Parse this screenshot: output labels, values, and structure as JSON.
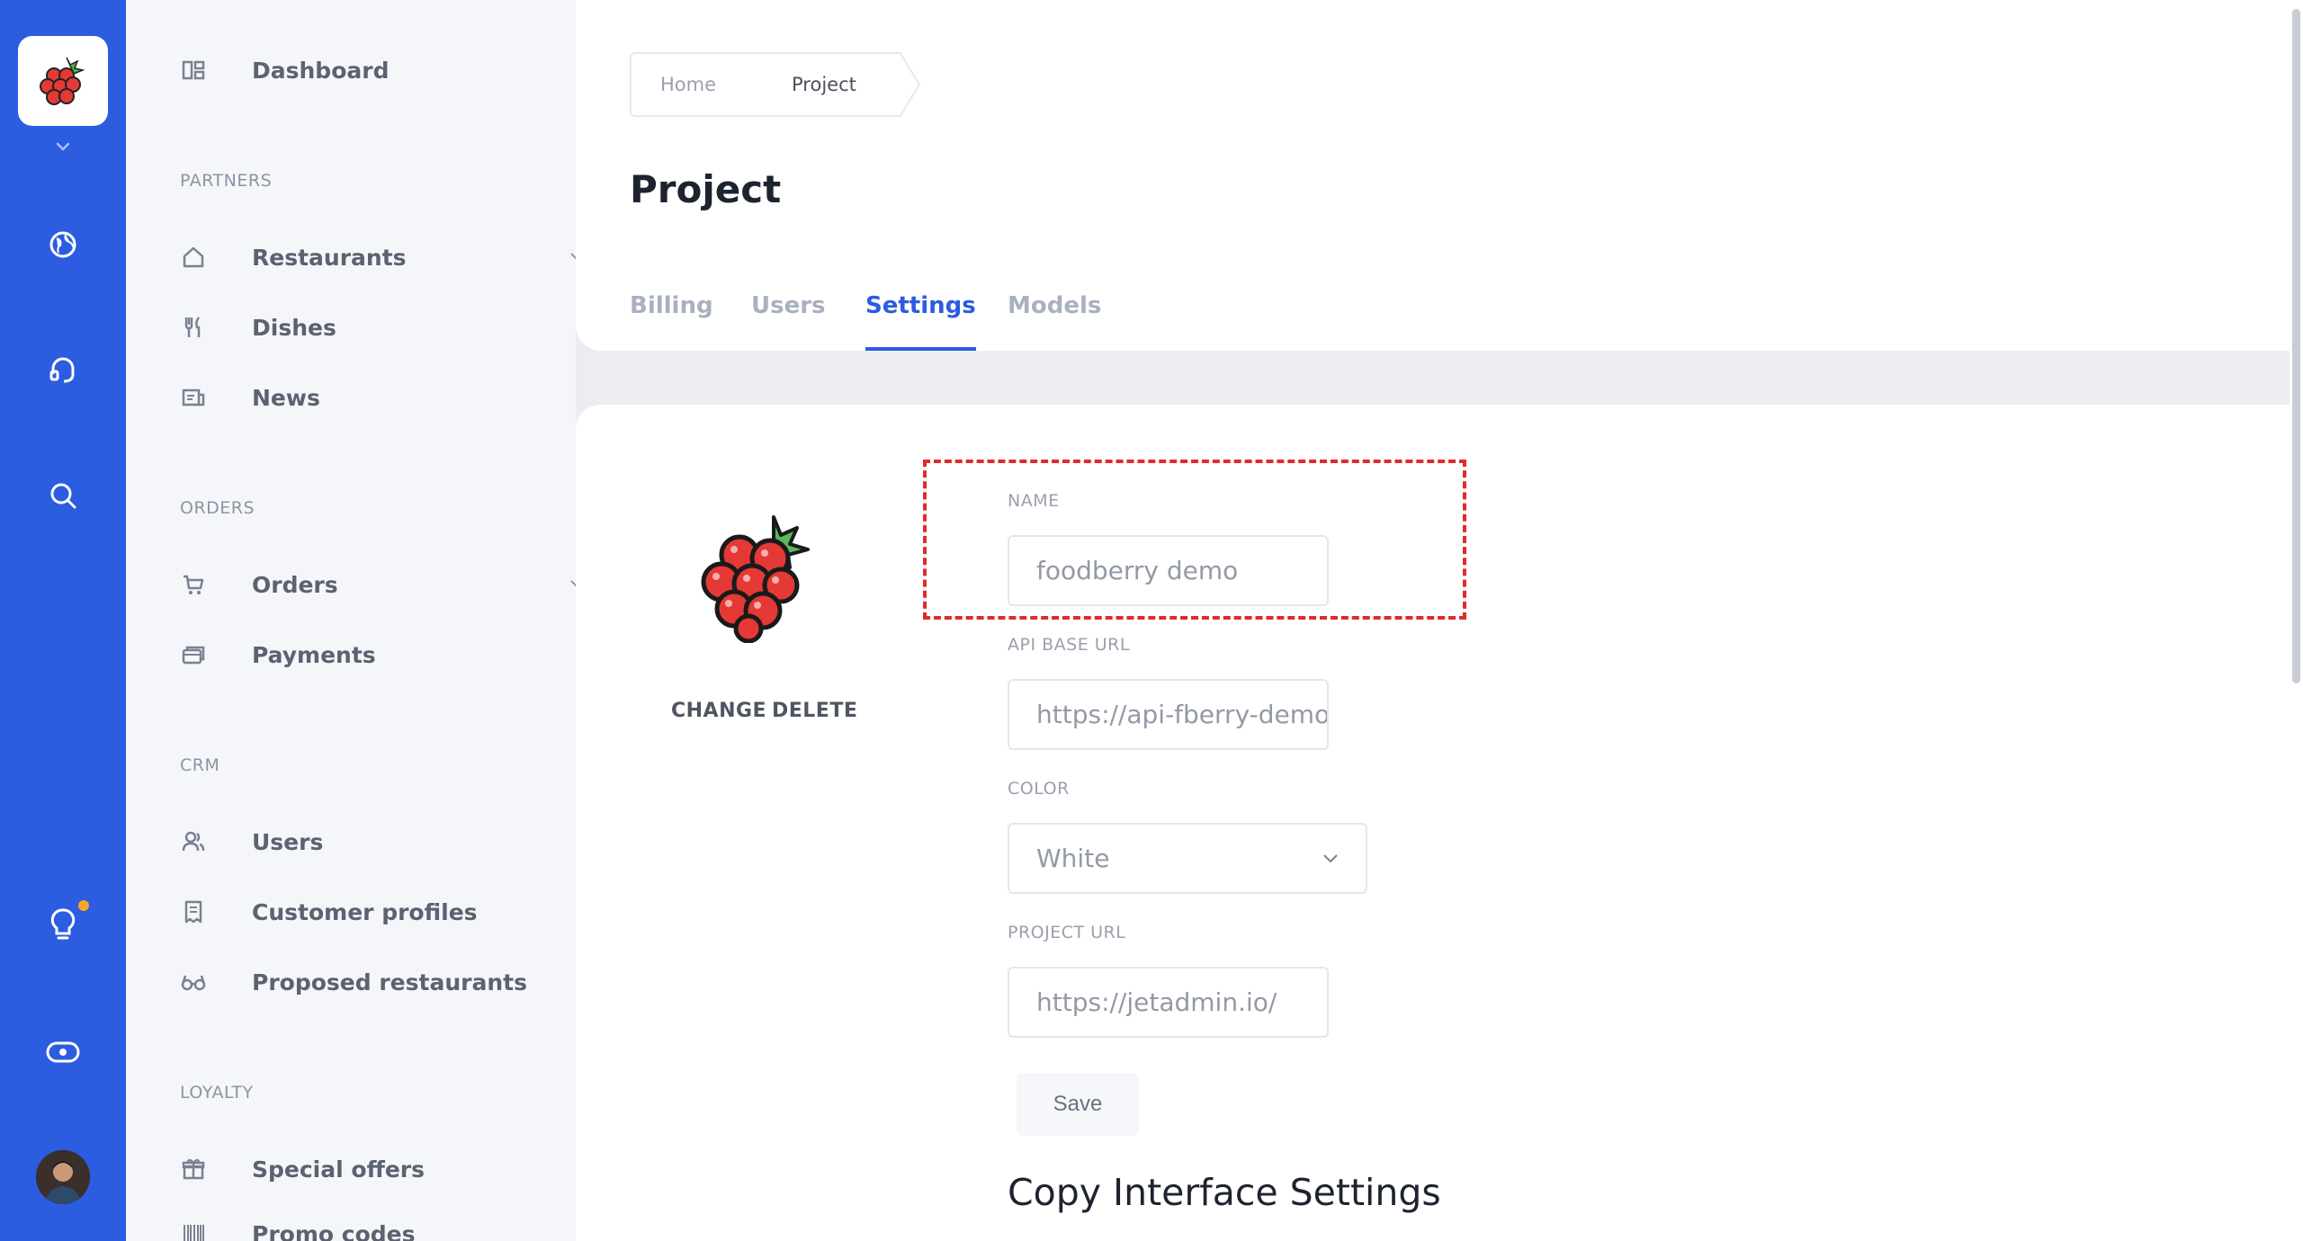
{
  "rail": {
    "icons": [
      "raspberry-logo-icon",
      "chevron-down-icon",
      "globe-icon",
      "headset-icon",
      "search-icon",
      "lightbulb-icon",
      "toggle-icon"
    ],
    "notification_color": "#f5a623",
    "accent": "#2c5ce0"
  },
  "sidebar": {
    "dashboard": "Dashboard",
    "sections": {
      "partners": "PARTNERS",
      "orders": "ORDERS",
      "crm": "CRM",
      "loyalty": "LOYALTY"
    },
    "items": {
      "restaurants": "Restaurants",
      "dishes": "Dishes",
      "news": "News",
      "orders": "Orders",
      "payments": "Payments",
      "users": "Users",
      "customer_profiles": "Customer profiles",
      "proposed_restaurants": "Proposed restaurants",
      "special_offers": "Special offers",
      "promo_codes": "Promo codes"
    }
  },
  "breadcrumb": {
    "home": "Home",
    "current": "Project"
  },
  "page": {
    "title": "Project"
  },
  "tabs": [
    {
      "label": "Billing",
      "active": false
    },
    {
      "label": "Users",
      "active": false
    },
    {
      "label": "Settings",
      "active": true
    },
    {
      "label": "Models",
      "active": false
    }
  ],
  "logo_actions": {
    "change": "CHANGE",
    "delete": "DELETE"
  },
  "form": {
    "name_label": "NAME",
    "name_value": "foodberry demo",
    "api_label": "API BASE URL",
    "api_value": "https://api-fberry-demo",
    "color_label": "COLOR",
    "color_value": "White",
    "project_url_label": "PROJECT URL",
    "project_url_value": "https://jetadmin.io/",
    "save": "Save"
  },
  "copy_section": {
    "heading": "Copy Interface Settings"
  },
  "highlight_color": "#e02b2b"
}
